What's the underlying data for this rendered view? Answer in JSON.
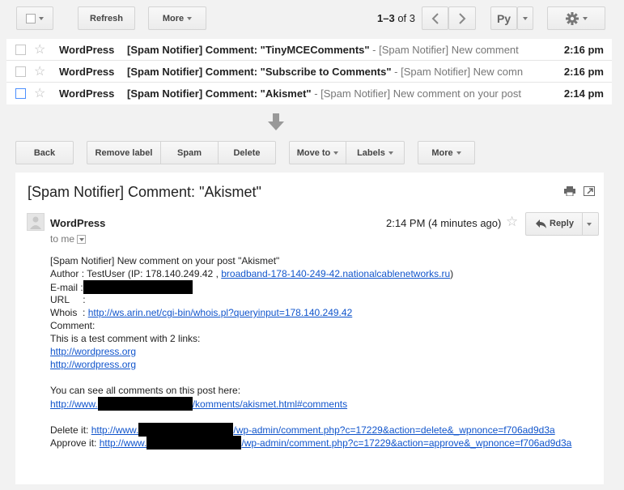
{
  "toolbar_top": {
    "refresh_label": "Refresh",
    "more_label": "More",
    "range": "1–3",
    "of_label": "of 3",
    "input_tool_label": "Ру"
  },
  "inbox": [
    {
      "sender": "WordPress",
      "subject": "[Spam Notifier] Comment: \"TinyMCEComments\"",
      "snippet": " - [Spam Notifier] New comment",
      "time": "2:16 pm"
    },
    {
      "sender": "WordPress",
      "subject": "[Spam Notifier] Comment: \"Subscribe to Comments\"",
      "snippet": " - [Spam Notifier] New comn",
      "time": "2:16 pm"
    },
    {
      "sender": "WordPress",
      "subject": "[Spam Notifier] Comment: \"Akismet\"",
      "snippet": " - [Spam Notifier] New comment on your post",
      "time": "2:14 pm"
    }
  ],
  "toolbar_msg": {
    "back": "Back",
    "remove_label": "Remove label",
    "spam": "Spam",
    "delete": "Delete",
    "move_to": "Move to",
    "labels": "Labels",
    "more": "More"
  },
  "message": {
    "title": "[Spam Notifier]  Comment: \"Akismet\"",
    "from": "WordPress",
    "to": "to me",
    "date": "2:14 PM (4 minutes ago)",
    "reply_label": "Reply",
    "body": {
      "l1": "[Spam Notifier] New comment on your post \"Akismet\"",
      "author_prefix": "Author : TestUser   (IP: 178.140.249.42 , ",
      "author_link": "broadband-178-140-249-42.nationalcablenetworks.ru",
      "author_suffix": ")",
      "email_label": "E-mail :",
      "url_label": "URL     :",
      "whois_label": "Whois  : ",
      "whois_link": "http://ws.arin.net/cgi-bin/whois.pl?queryinput=178.140.249.42",
      "comment_label": "Comment:",
      "comment_text": "This is a test comment with 2 links:",
      "link1": "http://wordpress.org",
      "link2": "http://wordpress.org",
      "see_all": "You can see all comments on this post here:",
      "see_all_link_start": "http://www.",
      "see_all_link_end": "/komments/akismet.html#comments",
      "delete_label": "Delete it: ",
      "delete_link_start": "http://www.",
      "delete_link_end": "/wp-admin/comment.php?c=17229&action=delete&_wpnonce=f706ad9d3a",
      "approve_label": "Approve it: ",
      "approve_link_start": "http://www.",
      "approve_link_end": "/wp-admin/comment.php?c=17229&action=approve&_wpnonce=f706ad9d3a"
    }
  }
}
